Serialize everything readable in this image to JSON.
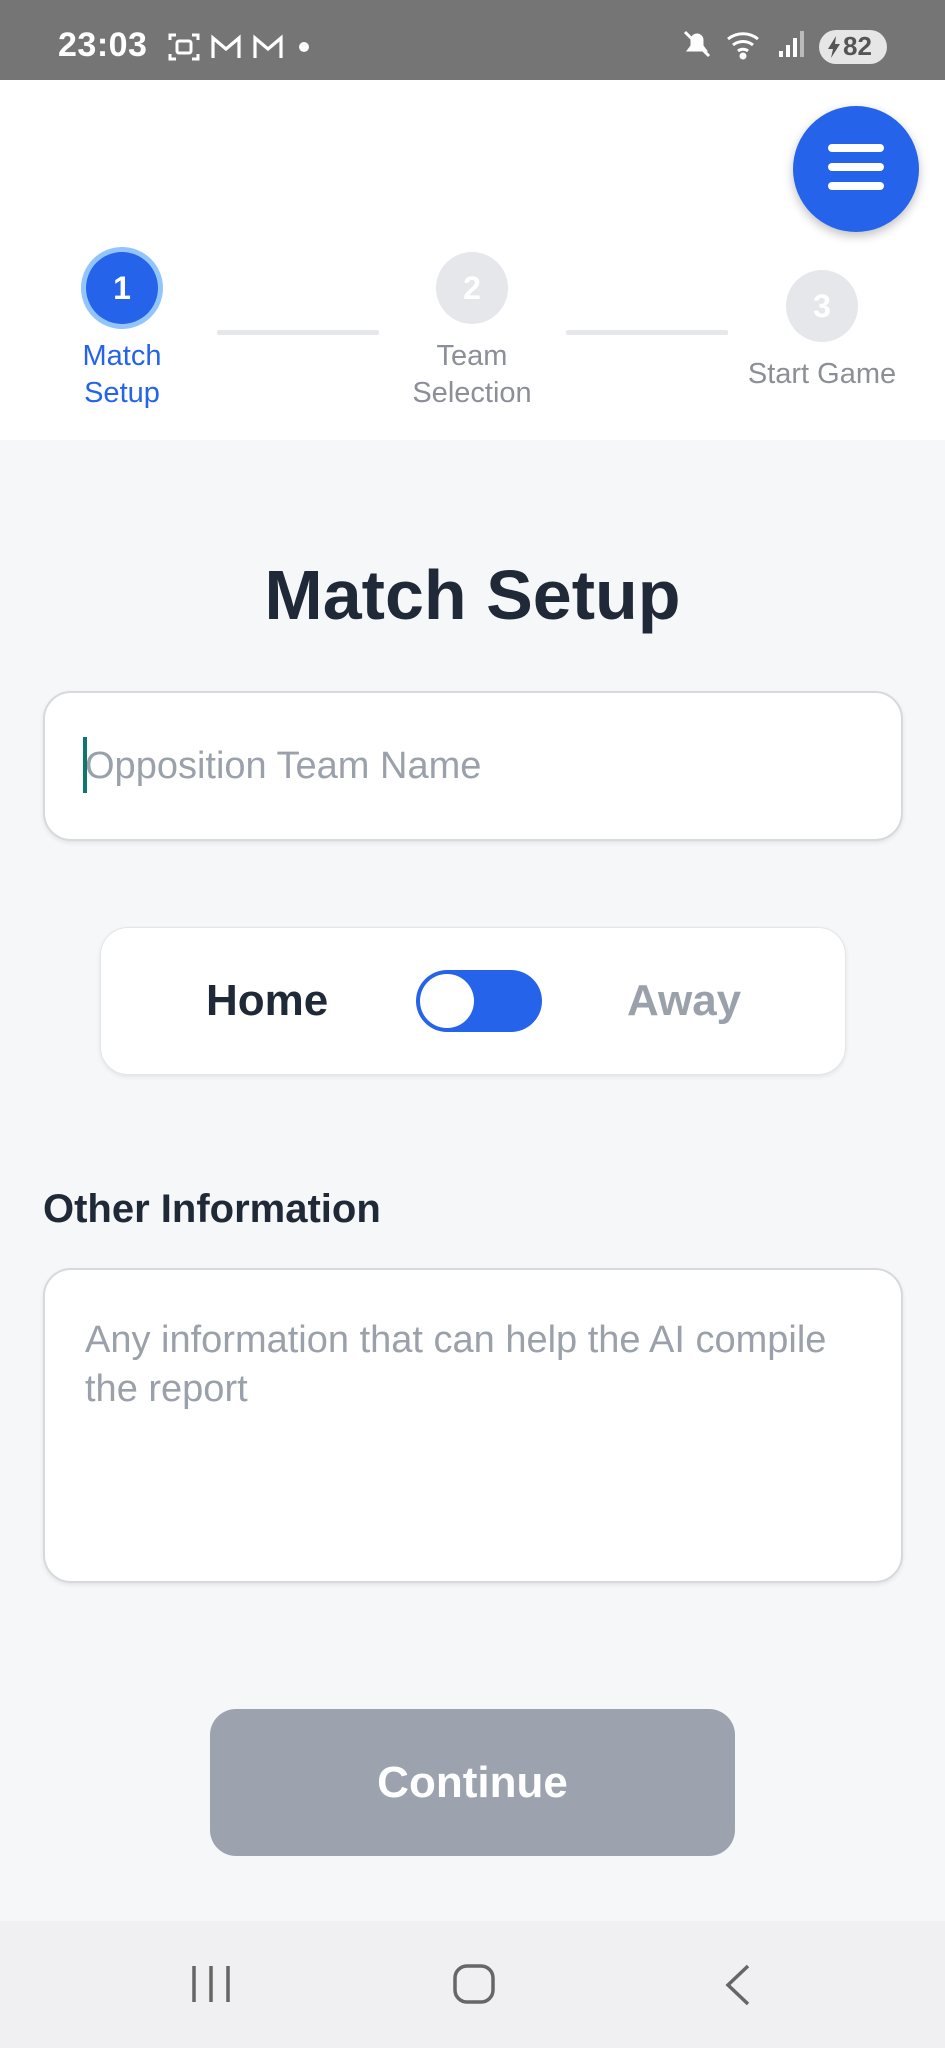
{
  "status_bar": {
    "time": "23:03",
    "battery": "82",
    "icons_left": [
      "screenshot-icon",
      "gmail-icon",
      "gmail-icon",
      "dot-icon"
    ],
    "icons_right": [
      "mute-icon",
      "wifi-icon",
      "signal-icon",
      "battery-icon"
    ]
  },
  "stepper": {
    "steps": [
      {
        "number": "1",
        "label_line1": "Match",
        "label_line2": "Setup",
        "state": "active"
      },
      {
        "number": "2",
        "label_line1": "Team",
        "label_line2": "Selection",
        "state": "inactive"
      },
      {
        "number": "3",
        "label_line1": "Start Game",
        "label_line2": "",
        "state": "inactive"
      }
    ]
  },
  "page": {
    "title": "Match Setup"
  },
  "opposition": {
    "placeholder": "Opposition Team Name",
    "value": ""
  },
  "venue_toggle": {
    "home_label": "Home",
    "away_label": "Away",
    "selected": "Home"
  },
  "other_info": {
    "label": "Other Information",
    "placeholder": "Any information that can help the AI compile the report",
    "value": ""
  },
  "actions": {
    "continue_label": "Continue"
  },
  "colors": {
    "accent": "#2563eb",
    "disabled_button": "#9ca3af",
    "title_text": "#1f2937",
    "muted_text": "#9aa1ab"
  }
}
